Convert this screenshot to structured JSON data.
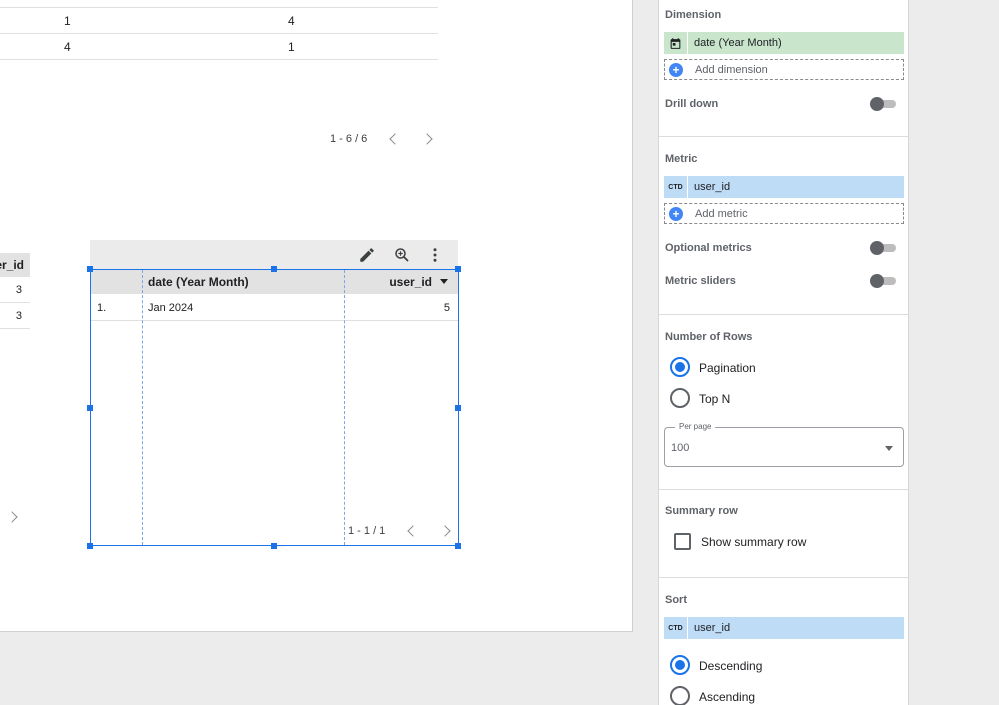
{
  "canvas": {
    "top_table": {
      "rows": [
        {
          "c1": "1",
          "c2": "4"
        },
        {
          "c1": "4",
          "c2": "1"
        }
      ],
      "pager": "1 - 6 / 6"
    },
    "left_table": {
      "header": "er_id",
      "values": [
        "3",
        "3"
      ]
    },
    "selected_table": {
      "columns": [
        "date (Year Month)",
        "user_id"
      ],
      "rows": [
        {
          "index": "1.",
          "date": "Jan 2024",
          "value": "5"
        }
      ],
      "pager": "1 - 1 / 1",
      "toolbar": {
        "edit_icon": "pencil-icon",
        "explore_icon": "zoom-explore-icon",
        "more_icon": "more-vert-icon"
      }
    }
  },
  "panel": {
    "dimension": {
      "title": "Dimension",
      "chip": "date (Year Month)",
      "add_label": "Add dimension"
    },
    "drill_down": {
      "label": "Drill down"
    },
    "metric": {
      "title": "Metric",
      "chip_type": "CTD",
      "chip": "user_id",
      "add_label": "Add metric"
    },
    "optional_metrics": {
      "label": "Optional metrics"
    },
    "metric_sliders": {
      "label": "Metric sliders"
    },
    "rows": {
      "title": "Number of Rows",
      "option_pagination": "Pagination",
      "option_topn": "Top N",
      "per_page_label": "Per page",
      "per_page_value": "100"
    },
    "summary": {
      "title": "Summary row",
      "checkbox_label": "Show summary row"
    },
    "sort": {
      "title": "Sort",
      "chip_type": "CTD",
      "chip": "user_id",
      "option_desc": "Descending",
      "option_asc": "Ascending"
    },
    "colors": {
      "dimension_chip": "#c9e6cd",
      "metric_chip": "#bfdcf7",
      "accent": "#1a73e8"
    }
  }
}
